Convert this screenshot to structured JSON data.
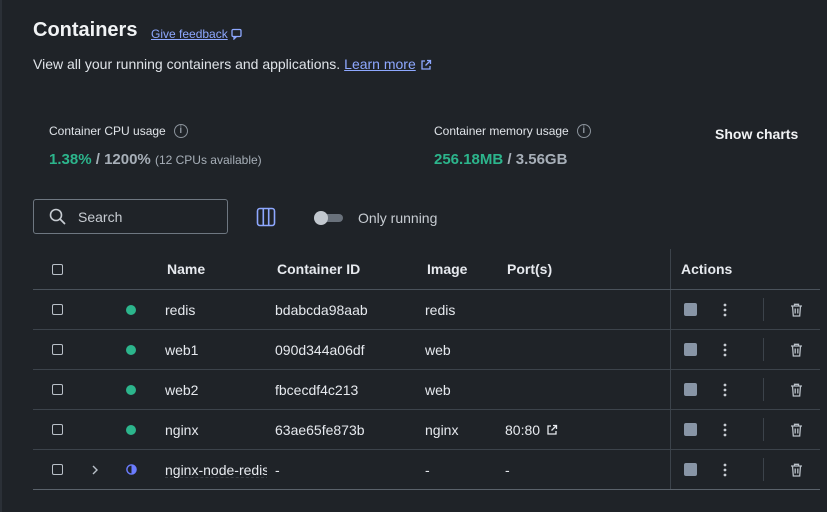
{
  "header": {
    "title": "Containers",
    "feedback_label": "Give feedback",
    "subtitle": "View all your running containers and applications.",
    "learn_more_label": "Learn more"
  },
  "stats": {
    "cpu_label": "Container CPU usage",
    "cpu_used": "1.38%",
    "cpu_sep": " / ",
    "cpu_total": "1200%",
    "cpu_note": "(12 CPUs available)",
    "mem_label": "Container memory usage",
    "mem_used": "256.18MB",
    "mem_sep": " / ",
    "mem_total": "3.56GB",
    "show_charts_label": "Show charts"
  },
  "toolbar": {
    "search_placeholder": "Search",
    "only_running_label": "Only running",
    "only_running_enabled": false
  },
  "table": {
    "headers": {
      "name": "Name",
      "container_id": "Container ID",
      "image": "Image",
      "ports": "Port(s)",
      "actions": "Actions"
    },
    "rows": [
      {
        "name": "redis",
        "id": "bdabcda98aab",
        "image": "redis",
        "ports": "",
        "status": "running",
        "status_color": "#2cb58c"
      },
      {
        "name": "web1",
        "id": "090d344a06df",
        "image": "web",
        "ports": "",
        "status": "running",
        "status_color": "#2cb58c"
      },
      {
        "name": "web2",
        "id": "fbcecdf4c213",
        "image": "web",
        "ports": "",
        "status": "running",
        "status_color": "#2cb58c"
      },
      {
        "name": "nginx",
        "id": "63ae65fe873b",
        "image": "nginx",
        "ports": "80:80",
        "status": "running",
        "status_color": "#2cb58c"
      },
      {
        "name": "nginx-node-redis",
        "id": "-",
        "image": "-",
        "ports": "-",
        "status": "partially-running",
        "status_color": "#6b7cff",
        "expandable": true
      }
    ]
  },
  "colors": {
    "background": "#1f2328",
    "accent_link": "#8ea8ff",
    "running": "#2cb58c",
    "partial": "#6b7cff"
  }
}
